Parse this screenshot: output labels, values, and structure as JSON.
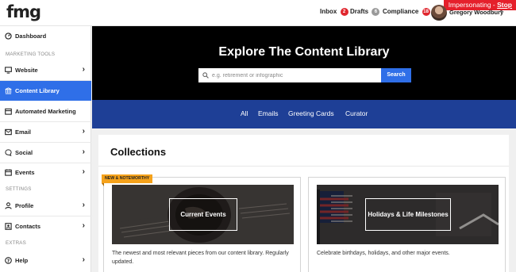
{
  "header": {
    "logo": "fmg",
    "impersonating_label": "Impersonating - ",
    "stop_label": "Stop",
    "nav": [
      {
        "label": "Inbox",
        "count": "2"
      },
      {
        "label": "Drafts",
        "count": "6"
      },
      {
        "label": "Compliance",
        "count": "18"
      }
    ],
    "user_name": "Gregory Woodbury",
    "user_caret": "▾"
  },
  "sidebar": {
    "dashboard": "Dashboard",
    "section_marketing": "MARKETING TOOLS",
    "website": "Website",
    "content_library": "Content Library",
    "automated_marketing": "Automated Marketing",
    "email": "Email",
    "social": "Social",
    "events": "Events",
    "section_settings": "SETTINGS",
    "profile": "Profile",
    "contacts": "Contacts",
    "section_extras": "EXTRAS",
    "help": "Help",
    "chevron": "›"
  },
  "hero": {
    "title": "Explore The Content Library",
    "search_placeholder": "e.g. retirement or infographic",
    "search_button": "Search"
  },
  "tabs": [
    "All",
    "Emails",
    "Greeting Cards",
    "Curator"
  ],
  "collections": {
    "title": "Collections",
    "cards": [
      {
        "ribbon": "NEW & NOTEWORTHY",
        "label": "Current Events",
        "description": "The newest and most relevant pieces from our content library. Regularly updated."
      },
      {
        "label": "Holidays & Life Milestones",
        "description": "Celebrate birthdays, holidays, and other major events."
      }
    ]
  },
  "colors": {
    "accent_blue": "#2f6fe8",
    "tab_bar_navy": "#1e3f96",
    "alert_red": "#e5202b",
    "ribbon_orange": "#f5a21b"
  }
}
